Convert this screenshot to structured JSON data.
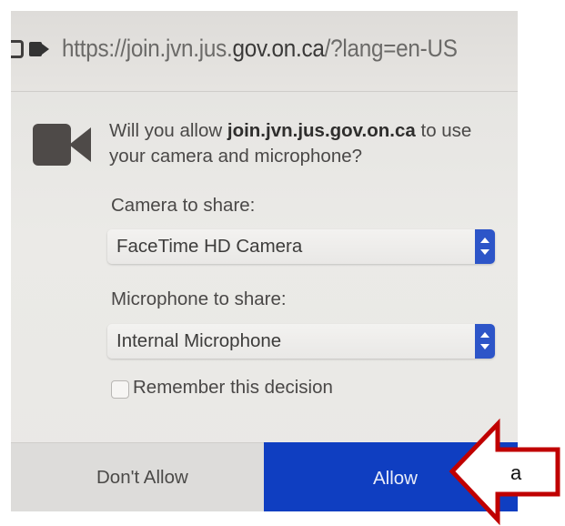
{
  "browser": {
    "url_prefix": "https://",
    "url_host_sub": "join.jvn.jus.",
    "url_host_main": "gov.on.ca",
    "url_path": "/?lang=en-US"
  },
  "permission_dialog": {
    "prompt_before": "Will you allow ",
    "prompt_domain": "join.jvn.jus.gov.on.ca",
    "prompt_after": " to use your camera and microphone?",
    "camera_label": "Camera to share:",
    "camera_value": "FaceTime HD Camera",
    "microphone_label": "Microphone to share:",
    "microphone_value": "Internal Microphone",
    "remember_label": "Remember this decision",
    "remember_checked": false,
    "deny_label": "Don't Allow",
    "allow_label": "Allow"
  },
  "annotation": {
    "arrow_label": "a",
    "arrow_color": "#c00000"
  },
  "colors": {
    "allow_button": "#0f3ec1",
    "stepper": "#2d55c8"
  },
  "icons": [
    "chat-icon",
    "video-camera-icon"
  ]
}
